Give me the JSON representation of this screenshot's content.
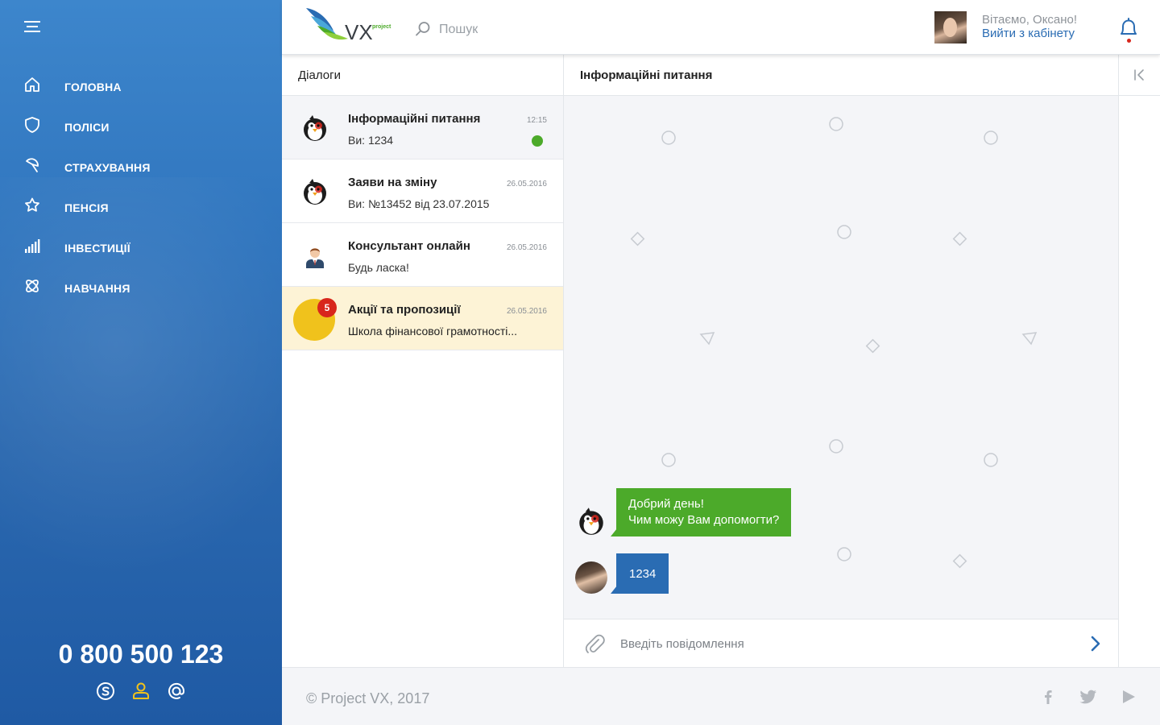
{
  "colors": {
    "sidebar": "#2f74bd",
    "brand_blue": "#2a6cb3",
    "green": "#4caa2a",
    "promo_bg": "#fdf3d6",
    "badge_red": "#d8261c",
    "promo_yellow": "#f0c21c"
  },
  "sidebar": {
    "toggle_icon": "hamburger-icon",
    "items": [
      {
        "label": "ГОЛОВНА",
        "icon": "home-icon"
      },
      {
        "label": "ПОЛІСИ",
        "icon": "shield-icon"
      },
      {
        "label": "СТРАХУВАННЯ",
        "icon": "umbrella-icon"
      },
      {
        "label": "ПЕНСІЯ",
        "icon": "star-icon"
      },
      {
        "label": "ІНВЕСТИЦІЇ",
        "icon": "bar-chart-icon"
      },
      {
        "label": "НАВЧАННЯ",
        "icon": "atom-icon"
      }
    ],
    "phone": "0 800 500 123",
    "contacts": [
      "skype-icon",
      "person-icon",
      "at-sign-icon"
    ]
  },
  "header": {
    "logo_text": "VX",
    "logo_sub": "project",
    "search_placeholder": "Пошук",
    "greeting": "Вітаємо, Оксано!",
    "logout": "Вийти з кабінету"
  },
  "dialogs": {
    "title": "Діалоги",
    "items": [
      {
        "title": "Інформаційні питання",
        "preview": "Ви: 1234",
        "time": "12:15"
      },
      {
        "title": "Заяви на зміну",
        "preview": "Ви: №13452 від 23.07.2015",
        "time": "26.05.2016"
      },
      {
        "title": "Консультант онлайн",
        "preview": "Будь ласка!",
        "time": "26.05.2016"
      },
      {
        "title": "Акції та пропозиції",
        "preview": "Школа фінансової грамотності...",
        "time": "26.05.2016",
        "badge": "5"
      }
    ]
  },
  "chat": {
    "title": "Інформаційні питання",
    "messages": [
      {
        "lines": [
          "Добрий день!",
          "Чим можу Вам допомогти?"
        ]
      },
      {
        "lines": [
          "1234"
        ]
      }
    ],
    "input_placeholder": "Введіть повідомлення"
  },
  "footer": {
    "copyright": "© Project VX, 2017",
    "social": [
      "facebook-icon",
      "twitter-icon",
      "youtube-icon"
    ]
  }
}
